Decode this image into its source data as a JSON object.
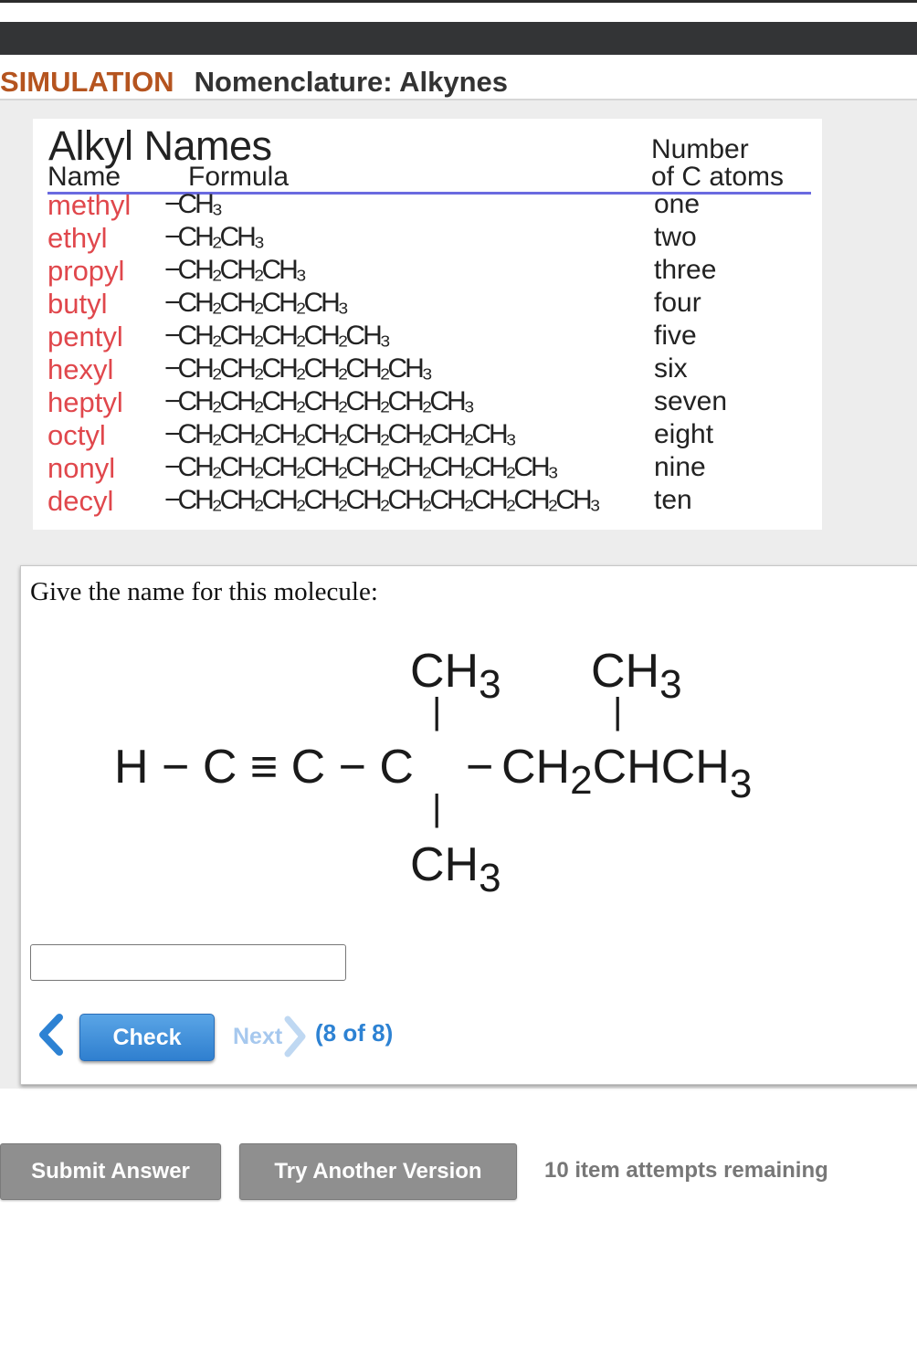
{
  "header": {
    "section_label": "SIMULATION",
    "title": "Nomenclature: Alkynes"
  },
  "alkyl_table": {
    "title": "Alkyl Names",
    "col_name": "Name",
    "col_formula": "Formula",
    "col_count_line1": "Number",
    "col_count_line2": "of C atoms",
    "rows": [
      {
        "name": "methyl",
        "formula": "−CH₃",
        "count": "one"
      },
      {
        "name": "ethyl",
        "formula": "−CH₂CH₃",
        "count": "two"
      },
      {
        "name": "propyl",
        "formula": "−CH₂CH₂CH₃",
        "count": "three"
      },
      {
        "name": "butyl",
        "formula": "−CH₂CH₂CH₂CH₃",
        "count": "four"
      },
      {
        "name": "pentyl",
        "formula": "−CH₂CH₂CH₂CH₂CH₃",
        "count": "five"
      },
      {
        "name": "hexyl",
        "formula": "−CH₂CH₂CH₂CH₂CH₂CH₃",
        "count": "six"
      },
      {
        "name": "heptyl",
        "formula": "−CH₂CH₂CH₂CH₂CH₂CH₂CH₃",
        "count": "seven"
      },
      {
        "name": "octyl",
        "formula": "−CH₂CH₂CH₂CH₂CH₂CH₂CH₂CH₃",
        "count": "eight"
      },
      {
        "name": "nonyl",
        "formula": "−CH₂CH₂CH₂CH₂CH₂CH₂CH₂CH₂CH₃",
        "count": "nine"
      },
      {
        "name": "decyl",
        "formula": "−CH₂CH₂CH₂CH₂CH₂CH₂CH₂CH₂CH₂CH₃",
        "count": "ten"
      }
    ]
  },
  "question": {
    "prompt": "Give the name for this molecule:",
    "molecule": {
      "ch": "CH",
      "sub3": "3",
      "sub2": "2",
      "main_chain_left": "H − C ≡ C − C",
      "main_chain_dash": "−",
      "main_chain_ch2": "CH",
      "main_chain_right": "CHCH",
      "bond_vertical": "|"
    },
    "answer_value": "",
    "answer_placeholder": ""
  },
  "nav": {
    "check_label": "Check",
    "next_label": "Next",
    "progress": "(8 of 8)"
  },
  "footer": {
    "submit_label": "Submit Answer",
    "try_another_label": "Try Another Version",
    "attempts": "10 item attempts remaining"
  },
  "colors": {
    "section_label": "#b5541f",
    "alkyl_name": "#e0474c",
    "check_button": "#3a8ad8",
    "progress": "#2d82d3",
    "next_disabled": "#a6c8ee",
    "gray_button": "#8f8f8f"
  }
}
